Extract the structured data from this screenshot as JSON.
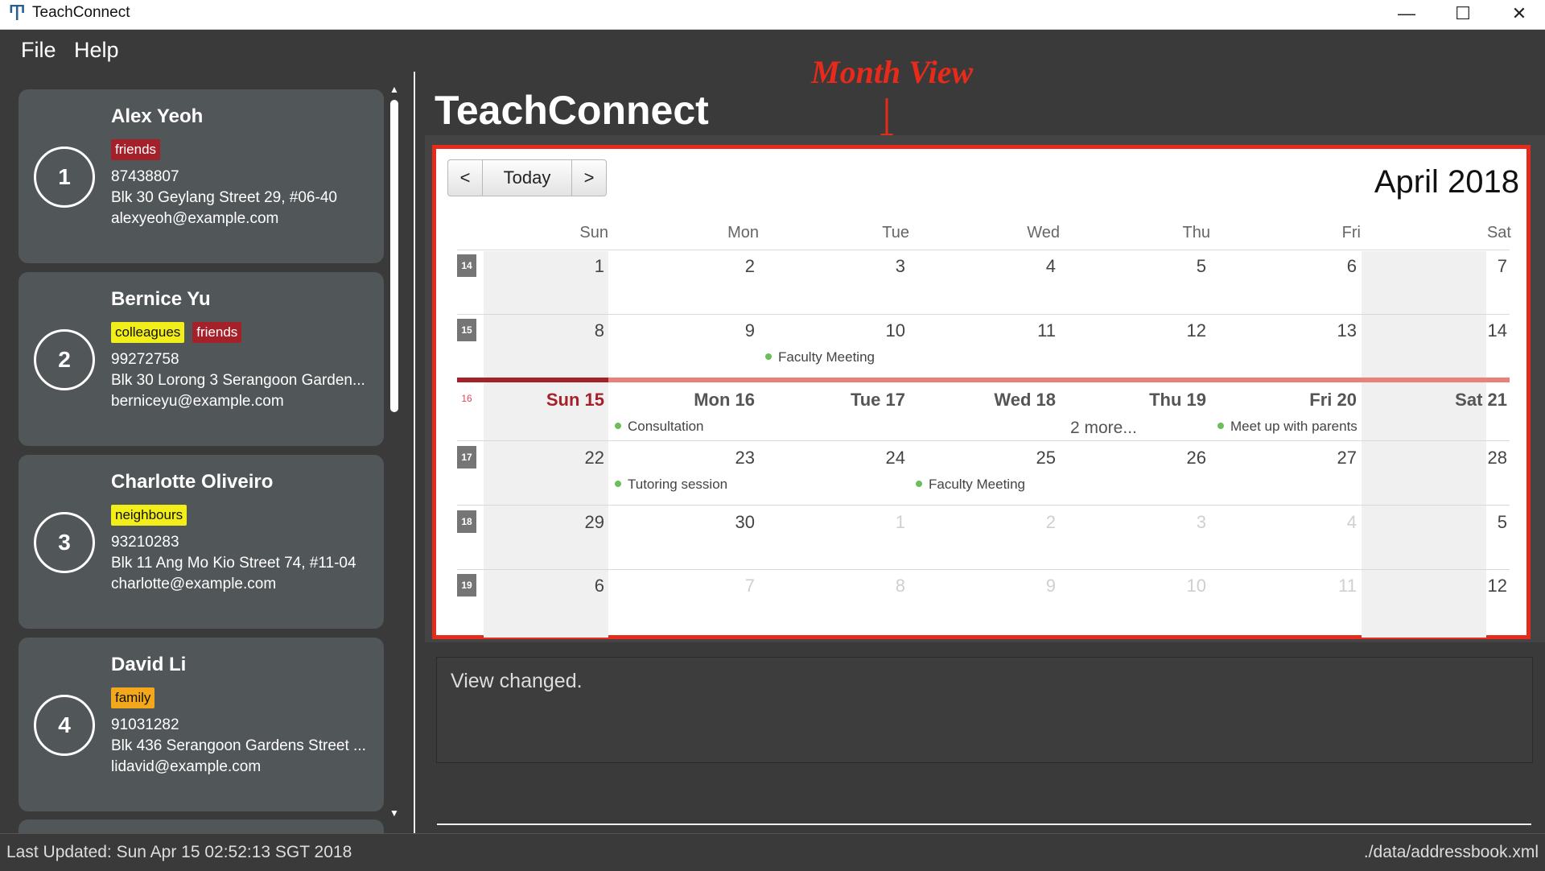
{
  "window": {
    "title": "TeachConnect",
    "minimize": "—",
    "maximize": "☐",
    "close": "✕"
  },
  "menu": {
    "file": "File",
    "help": "Help"
  },
  "contacts": [
    {
      "index": "1",
      "name": "Alex Yeoh",
      "tags": [
        {
          "label": "friends",
          "color": "#a5212a"
        }
      ],
      "phone": "87438807",
      "address": "Blk 30 Geylang Street 29, #06-40",
      "email": "alexyeoh@example.com"
    },
    {
      "index": "2",
      "name": "Bernice Yu",
      "tags": [
        {
          "label": "colleagues",
          "color": "#f2ee1a"
        },
        {
          "label": "friends",
          "color": "#a5212a"
        }
      ],
      "phone": "99272758",
      "address": "Blk 30 Lorong 3 Serangoon Garden...",
      "email": "berniceyu@example.com"
    },
    {
      "index": "3",
      "name": "Charlotte Oliveiro",
      "tags": [
        {
          "label": "neighbours",
          "color": "#f2ee1a"
        }
      ],
      "phone": "93210283",
      "address": "Blk 11 Ang Mo Kio Street 74, #11-04",
      "email": "charlotte@example.com"
    },
    {
      "index": "4",
      "name": "David Li",
      "tags": [
        {
          "label": "family",
          "color": "#f3a81c"
        }
      ],
      "phone": "91031282",
      "address": "Blk 436 Serangoon Gardens Street ...",
      "email": "lidavid@example.com"
    }
  ],
  "scroll": {
    "up": "▲",
    "down": "▼"
  },
  "main": {
    "title": "TeachConnect",
    "annotation": "Month View",
    "annotation_color": "#e82a1a"
  },
  "calendar": {
    "prev": "<",
    "today": "Today",
    "next": ">",
    "month_title": "April 2018",
    "weekdays": [
      "Sun",
      "Mon",
      "Tue",
      "Wed",
      "Thu",
      "Fri",
      "Sat"
    ],
    "weeks": [
      {
        "week_no": "14",
        "days": [
          "1",
          "2",
          "3",
          "4",
          "5",
          "6",
          "7"
        ]
      },
      {
        "week_no": "15",
        "days": [
          "8",
          "9",
          "10",
          "11",
          "12",
          "13",
          "14"
        ]
      },
      {
        "week_no": "16",
        "days": [
          "Sun 15",
          "Mon 16",
          "Tue 17",
          "Wed 18",
          "Thu 19",
          "Fri 20",
          "Sat 21"
        ]
      },
      {
        "week_no": "17",
        "days": [
          "22",
          "23",
          "24",
          "25",
          "26",
          "27",
          "28"
        ]
      },
      {
        "week_no": "18",
        "days": [
          "29",
          "30",
          "1",
          "2",
          "3",
          "4",
          "5"
        ]
      },
      {
        "week_no": "19",
        "days": [
          "6",
          "7",
          "8",
          "9",
          "10",
          "11",
          "12"
        ]
      }
    ],
    "events": {
      "faculty_meeting_9": "Faculty Meeting",
      "consultation": "Consultation",
      "more": "2 more...",
      "meet_parents": "Meet up with parents",
      "tutoring": "Tutoring session",
      "faculty_meeting_25": "Faculty Meeting"
    },
    "accent_today": "#a5212a",
    "event_dot_color": "#6bbf59"
  },
  "result": {
    "text": "View changed."
  },
  "status": {
    "last_updated": "Last Updated: Sun Apr 15 02:52:13 SGT 2018",
    "file_path": "./data/addressbook.xml"
  }
}
